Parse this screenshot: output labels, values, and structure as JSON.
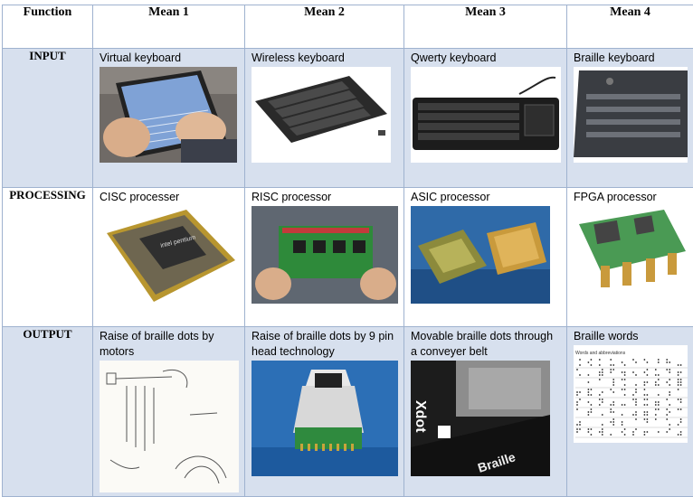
{
  "table": {
    "headers": [
      "Function",
      "Mean 1",
      "Mean 2",
      "Mean 3",
      "Mean 4"
    ],
    "rows": [
      {
        "function": "INPUT",
        "means": [
          "Virtual keyboard",
          "Wireless keyboard",
          "Qwerty keyboard",
          "Braille keyboard"
        ]
      },
      {
        "function": "PROCESSING",
        "means": [
          "CISC processer",
          "RISC processor",
          "ASIC processor",
          "FPGA processor"
        ]
      },
      {
        "function": "OUTPUT",
        "means": [
          "Raise of braille dots by motors",
          "Raise of braille dots by 9 pin head technology",
          "Movable braille dots through a conveyer belt",
          "Braille words"
        ]
      }
    ]
  },
  "image_text": {
    "pentium_logo": "intel pentium",
    "xdot_logo": "Xdot",
    "braille_sign": "Braille",
    "braille_chart_title": "Words and abbreviations"
  },
  "colors": {
    "cell_blue": "#d7e0ee",
    "border": "#9fb2cf"
  }
}
